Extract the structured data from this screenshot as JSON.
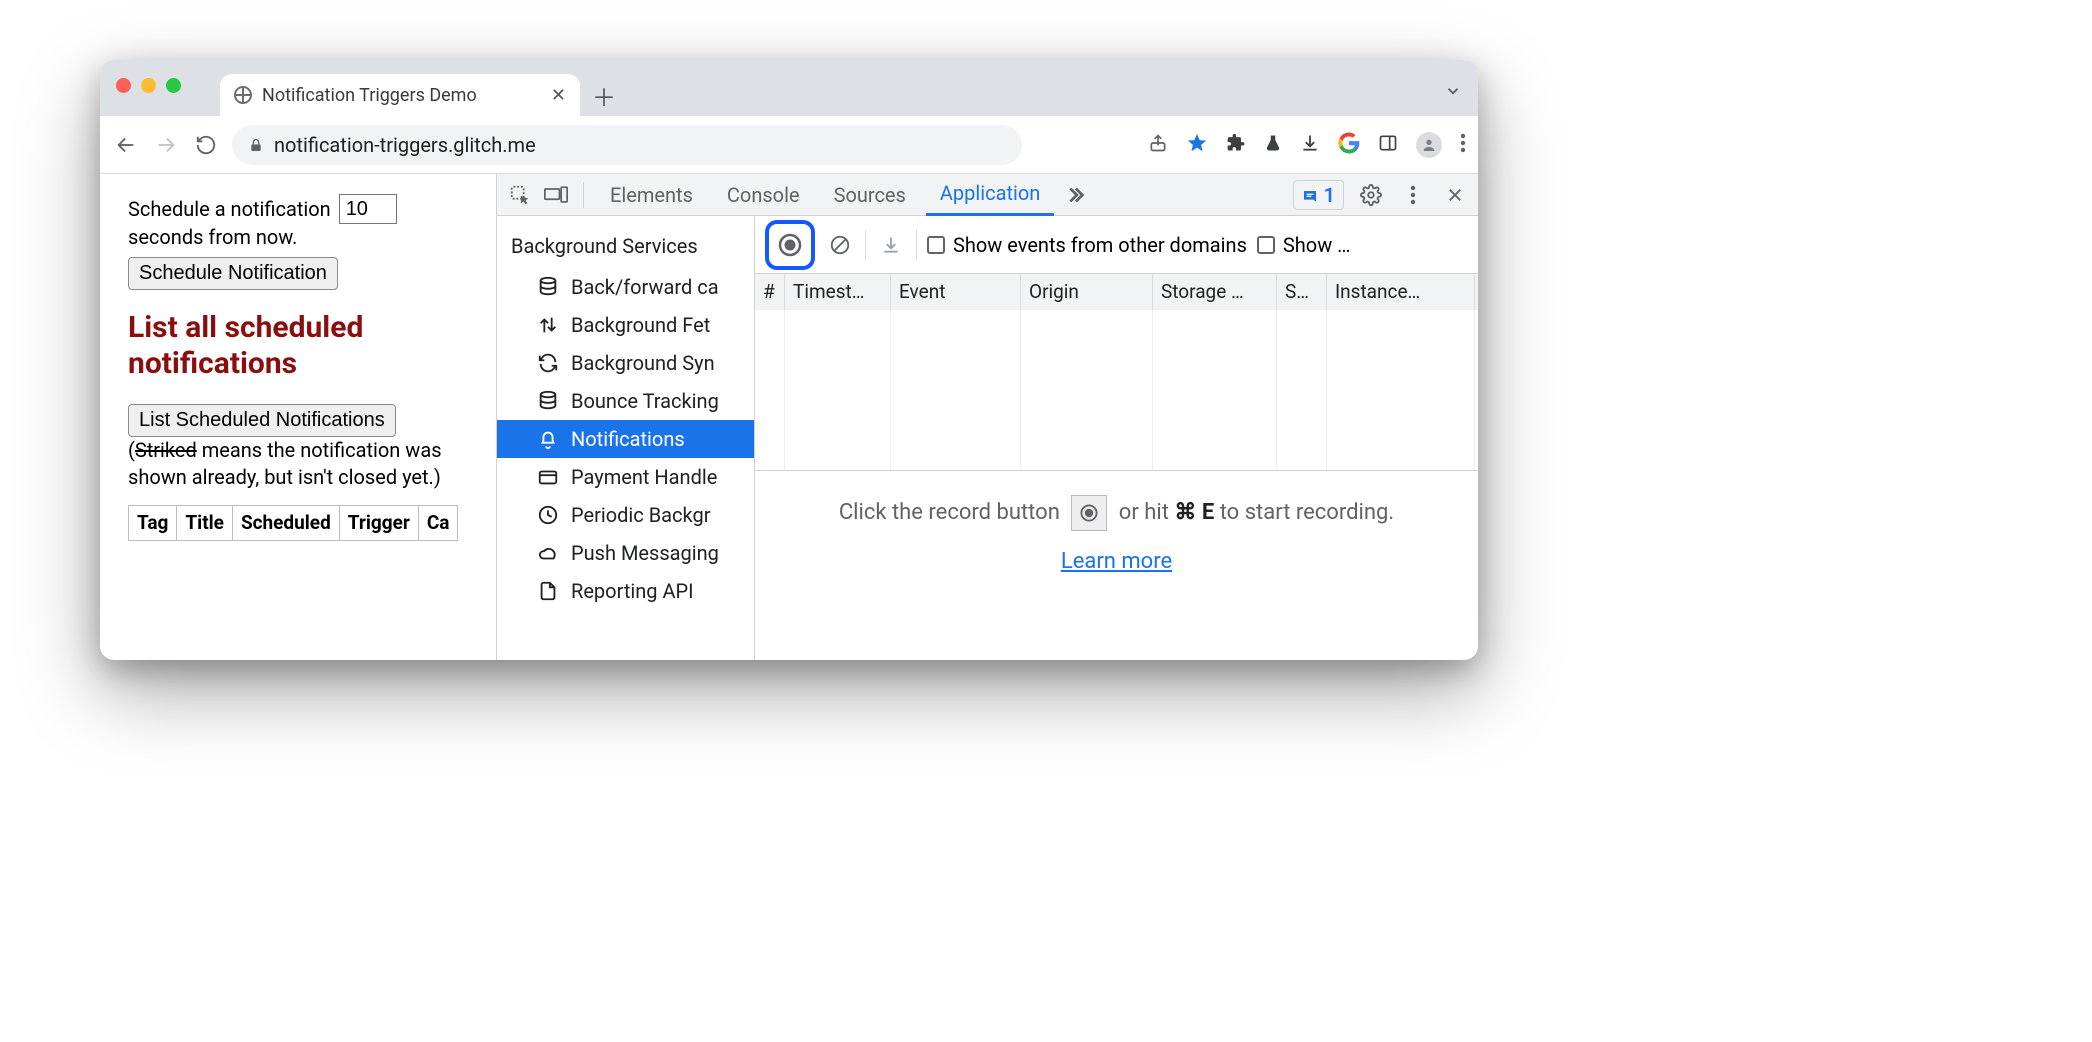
{
  "browser": {
    "tab_title": "Notification Triggers Demo",
    "url": "notification-triggers.glitch.me"
  },
  "page": {
    "schedule_prefix": "Schedule a notification",
    "schedule_value": "10",
    "schedule_suffix": "seconds from now.",
    "schedule_button": "Schedule Notification",
    "heading": "List all scheduled notifications",
    "list_button": "List Scheduled Notifications",
    "note_open": "(",
    "note_strike": "Striked",
    "note_rest": " means the notification was shown already, but isn't closed yet.)",
    "table_headers": [
      "Tag",
      "Title",
      "Scheduled",
      "Trigger",
      "Ca"
    ]
  },
  "devtools": {
    "tabs": {
      "elements": "Elements",
      "console": "Console",
      "sources": "Sources",
      "application": "Application"
    },
    "issues_count": "1",
    "sidebar": {
      "header": "Background Services",
      "items": [
        {
          "label": "Back/forward ca",
          "icon": "db"
        },
        {
          "label": "Background Fet",
          "icon": "updown"
        },
        {
          "label": "Background Syn",
          "icon": "sync"
        },
        {
          "label": "Bounce Tracking",
          "icon": "db"
        },
        {
          "label": "Notifications",
          "icon": "bell",
          "selected": true
        },
        {
          "label": "Payment Handle",
          "icon": "card"
        },
        {
          "label": "Periodic Backgr",
          "icon": "clock"
        },
        {
          "label": "Push Messaging",
          "icon": "cloud"
        },
        {
          "label": "Reporting API",
          "icon": "doc"
        }
      ]
    },
    "toolbar": {
      "show_other_domains": "Show events from other domains",
      "show_truncated": "Show …"
    },
    "grid_headers": [
      "#",
      "Timest…",
      "Event",
      "Origin",
      "Storage …",
      "S…",
      "Instance…"
    ],
    "hint": {
      "pre": "Click the record button ",
      "mid": " or hit ",
      "shortcut_sym": "⌘",
      "shortcut_key": "E",
      "post": " to start recording.",
      "learn_more": "Learn more"
    }
  }
}
